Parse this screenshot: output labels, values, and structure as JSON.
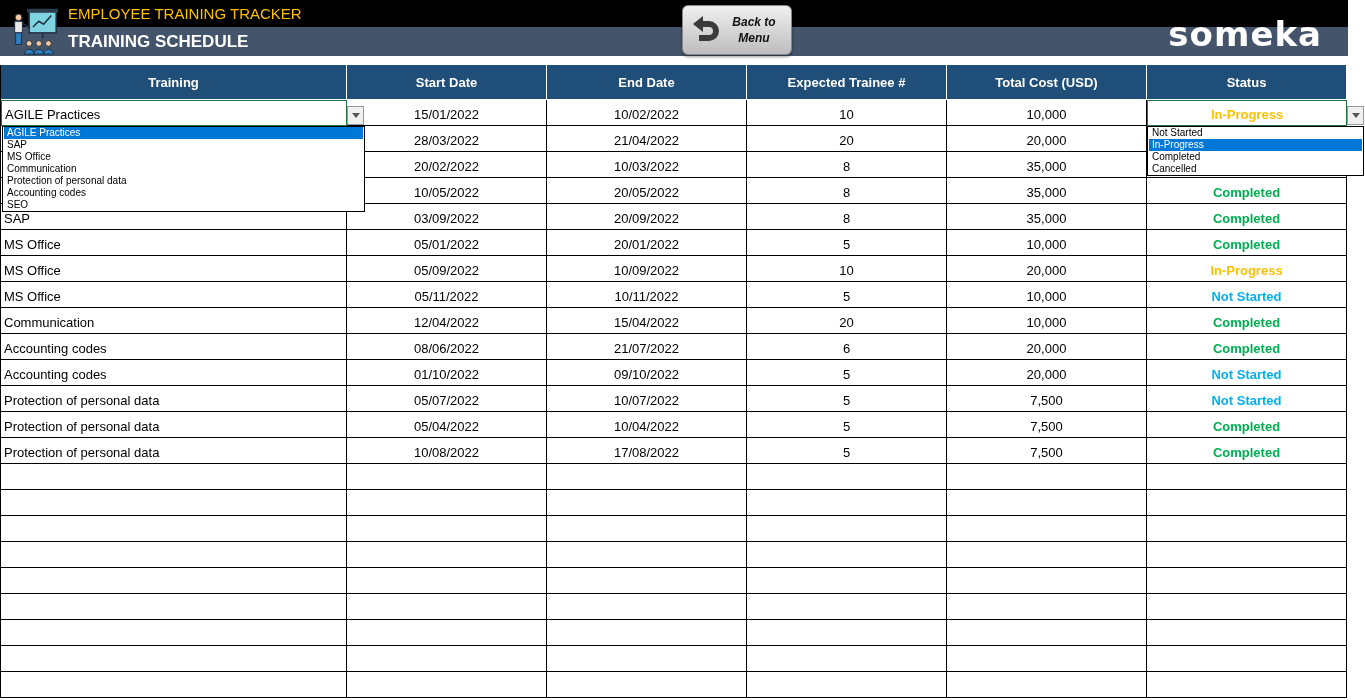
{
  "header": {
    "app_title": "EMPLOYEE TRAINING TRACKER",
    "page_title": "TRAINING SCHEDULE",
    "back_button": "Back to Menu",
    "brand": "someka"
  },
  "table": {
    "columns": [
      "Training",
      "Start Date",
      "End Date",
      "Expected  Trainee #",
      "Total Cost (USD)",
      "Status"
    ],
    "rows": [
      {
        "training": "AGILE Practices",
        "start": "15/01/2022",
        "end": "10/02/2022",
        "trainees": "10",
        "cost": "10,000",
        "status": {
          "text": "In-Progress",
          "color": "#ffc000"
        }
      },
      {
        "start": "28/03/2022",
        "end": "21/04/2022",
        "trainees": "20",
        "cost": "20,000"
      },
      {
        "start": "20/02/2022",
        "end": "10/03/2022",
        "trainees": "8",
        "cost": "35,000"
      },
      {
        "start": "10/05/2022",
        "end": "20/05/2022",
        "trainees": "8",
        "cost": "35,000",
        "status": {
          "text": "Completed",
          "color": "#00b050"
        }
      },
      {
        "training": "SAP",
        "start": "03/09/2022",
        "end": "20/09/2022",
        "trainees": "8",
        "cost": "35,000",
        "status": {
          "text": "Completed",
          "color": "#00b050"
        }
      },
      {
        "training": "MS Office",
        "start": "05/01/2022",
        "end": "20/01/2022",
        "trainees": "5",
        "cost": "10,000",
        "status": {
          "text": "Completed",
          "color": "#00b050"
        }
      },
      {
        "training": "MS Office",
        "start": "05/09/2022",
        "end": "10/09/2022",
        "trainees": "10",
        "cost": "20,000",
        "status": {
          "text": "In-Progress",
          "color": "#ffc000"
        }
      },
      {
        "training": "MS Office",
        "start": "05/11/2022",
        "end": "10/11/2022",
        "trainees": "5",
        "cost": "10,000",
        "status": {
          "text": "Not Started",
          "color": "#00b0f0"
        }
      },
      {
        "training": "Communication",
        "start": "12/04/2022",
        "end": "15/04/2022",
        "trainees": "20",
        "cost": "10,000",
        "status": {
          "text": "Completed",
          "color": "#00b050"
        }
      },
      {
        "training": "Accounting codes",
        "start": "08/06/2022",
        "end": "21/07/2022",
        "trainees": "6",
        "cost": "20,000",
        "status": {
          "text": "Completed",
          "color": "#00b050"
        }
      },
      {
        "training": "Accounting codes",
        "start": "01/10/2022",
        "end": "09/10/2022",
        "trainees": "5",
        "cost": "20,000",
        "status": {
          "text": "Not Started",
          "color": "#00b0f0"
        }
      },
      {
        "training": "Protection of personal data",
        "start": "05/07/2022",
        "end": "10/07/2022",
        "trainees": "5",
        "cost": "7,500",
        "status": {
          "text": "Not Started",
          "color": "#00b0f0"
        }
      },
      {
        "training": "Protection of personal data",
        "start": "05/04/2022",
        "end": "10/04/2022",
        "trainees": "5",
        "cost": "7,500",
        "status": {
          "text": "Completed",
          "color": "#00b050"
        }
      },
      {
        "training": "Protection of personal data",
        "start": "10/08/2022",
        "end": "17/08/2022",
        "trainees": "5",
        "cost": "7,500",
        "status": {
          "text": "Completed",
          "color": "#00b050"
        }
      }
    ]
  },
  "training_dropdown": {
    "options": [
      {
        "label": "AGILE Practices",
        "selected": true
      },
      {
        "label": "SAP",
        "selected": false
      },
      {
        "label": "MS Office",
        "selected": false
      },
      {
        "label": "Communication",
        "selected": false
      },
      {
        "label": "Protection of personal data",
        "selected": false
      },
      {
        "label": "Accounting codes",
        "selected": false
      },
      {
        "label": "SEO",
        "selected": false
      }
    ]
  },
  "status_dropdown": {
    "options": [
      {
        "label": "Not Started",
        "selected": false
      },
      {
        "label": "In-Progress",
        "selected": true
      },
      {
        "label": "Completed",
        "selected": false
      },
      {
        "label": "Cancelled",
        "selected": false
      }
    ]
  }
}
